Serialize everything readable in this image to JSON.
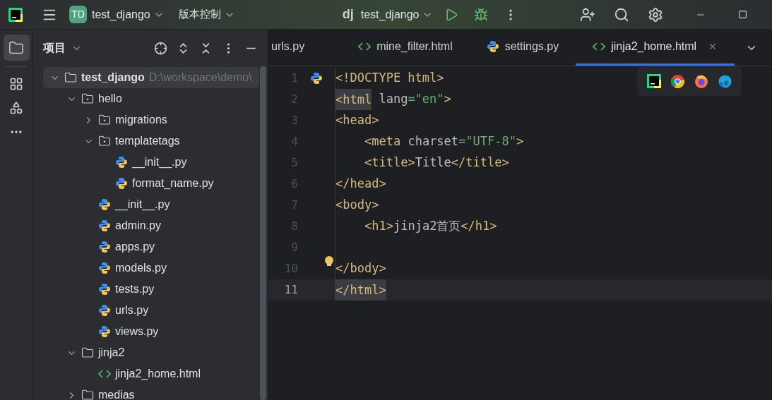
{
  "toolbar": {
    "project_badge": "TD",
    "project": "test_django",
    "vcs": "版本控制",
    "framework_mark": "dj",
    "run_config": "test_django"
  },
  "project_panel": {
    "title": "项目",
    "tree": [
      {
        "kind": "project",
        "name": "test_django",
        "path": "D:\\workspace\\demo\\",
        "expanded": true,
        "selected": true,
        "children": [
          {
            "kind": "module",
            "name": "hello",
            "expanded": true,
            "selected": false,
            "children": [
              {
                "kind": "module",
                "name": "migrations",
                "expanded": false,
                "selected": false
              },
              {
                "kind": "module",
                "name": "templatetags",
                "expanded": true,
                "selected": false,
                "children": [
                  {
                    "kind": "python",
                    "name": "__init__.py",
                    "selected": false
                  },
                  {
                    "kind": "python",
                    "name": "format_name.py",
                    "selected": false
                  }
                ]
              },
              {
                "kind": "python",
                "name": "__init__.py",
                "selected": false
              },
              {
                "kind": "python",
                "name": "admin.py",
                "selected": false
              },
              {
                "kind": "python",
                "name": "apps.py",
                "selected": false
              },
              {
                "kind": "python",
                "name": "models.py",
                "selected": false
              },
              {
                "kind": "python",
                "name": "tests.py",
                "selected": false
              },
              {
                "kind": "python",
                "name": "urls.py",
                "selected": false
              },
              {
                "kind": "python",
                "name": "views.py",
                "selected": false
              }
            ]
          },
          {
            "kind": "folder",
            "name": "jinja2",
            "expanded": true,
            "selected": false,
            "children": [
              {
                "kind": "html",
                "name": "jinja2_home.html",
                "selected": false
              }
            ]
          },
          {
            "kind": "folder",
            "name": "medias",
            "expanded": false,
            "selected": false
          }
        ]
      }
    ]
  },
  "tabs": [
    {
      "label": "urls.py",
      "selected": false
    },
    {
      "kind": "html",
      "label": "mine_filter.html",
      "selected": false
    },
    {
      "kind": "python",
      "label": "settings.py",
      "selected": false
    },
    {
      "kind": "html",
      "label": "jinja2_home.html",
      "selected": true
    }
  ],
  "editor": {
    "lines": [
      {
        "number": "1",
        "current": false,
        "tokens": [
          {
            "kind": "tag",
            "text": "<!DOCTYPE html>"
          }
        ]
      },
      {
        "number": "2",
        "current": false,
        "tokens": [
          {
            "kind": "tag",
            "text": "<html",
            "highlighted": true
          },
          {
            "kind": "attr",
            "text": " lang"
          },
          {
            "kind": "string",
            "text": "=\"en\""
          },
          {
            "kind": "tag",
            "text": ">"
          }
        ]
      },
      {
        "number": "3",
        "current": false,
        "tokens": [
          {
            "kind": "tag",
            "text": "<head>"
          }
        ]
      },
      {
        "number": "4",
        "current": false,
        "indent": true,
        "tokens": [
          {
            "kind": "tag",
            "text": "<meta"
          },
          {
            "kind": "attr",
            "text": " charset"
          },
          {
            "kind": "string",
            "text": "=\"UTF-8\""
          },
          {
            "kind": "tag",
            "text": ">"
          }
        ]
      },
      {
        "number": "5",
        "current": false,
        "indent": true,
        "tokens": [
          {
            "kind": "tag",
            "text": "<title>"
          },
          {
            "kind": "text",
            "text": "Title"
          },
          {
            "kind": "tag",
            "text": "</title>"
          }
        ]
      },
      {
        "number": "6",
        "current": false,
        "tokens": [
          {
            "kind": "tag",
            "text": "</head>"
          }
        ]
      },
      {
        "number": "7",
        "current": false,
        "tokens": [
          {
            "kind": "tag",
            "text": "<body>"
          }
        ]
      },
      {
        "number": "8",
        "current": false,
        "indent": true,
        "tokens": [
          {
            "kind": "tag",
            "text": "<h1>"
          },
          {
            "kind": "text",
            "text": "jinja2首页"
          },
          {
            "kind": "tag",
            "text": "</h1>"
          }
        ]
      },
      {
        "number": "9",
        "current": false
      },
      {
        "number": "10",
        "current": false,
        "bulb": true,
        "tokens": [
          {
            "kind": "tag",
            "text": "</body>"
          }
        ]
      },
      {
        "number": "11",
        "current": true,
        "tokens": [
          {
            "kind": "tag",
            "text": "</html>",
            "highlighted": true
          }
        ]
      }
    ]
  }
}
